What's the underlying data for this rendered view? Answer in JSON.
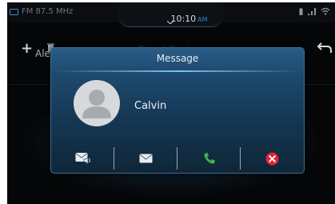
{
  "status_bar": {
    "radio_label": "FM 87.5 MHz",
    "time": "10:10",
    "ampm": "AM",
    "icons": [
      "battery-icon",
      "signal-icon",
      "wifi-icon"
    ]
  },
  "header": {
    "title": "Paired Devices",
    "add_icon": "plus-icon",
    "delete_icon": "trash-icon",
    "back_icon": "back-arrow-icon"
  },
  "list": {
    "first_row_text": "Ale"
  },
  "modal": {
    "title": "Message",
    "contact_name": "Calvin",
    "actions": [
      {
        "name": "read-message",
        "icon": "envelope-speaker-icon"
      },
      {
        "name": "reply-message",
        "icon": "envelope-icon"
      },
      {
        "name": "call",
        "icon": "phone-icon"
      },
      {
        "name": "dismiss",
        "icon": "close-icon"
      }
    ]
  },
  "colors": {
    "accent_blue": "#2f87c8",
    "call_green": "#3fb24a",
    "dismiss_red": "#e0233a"
  }
}
